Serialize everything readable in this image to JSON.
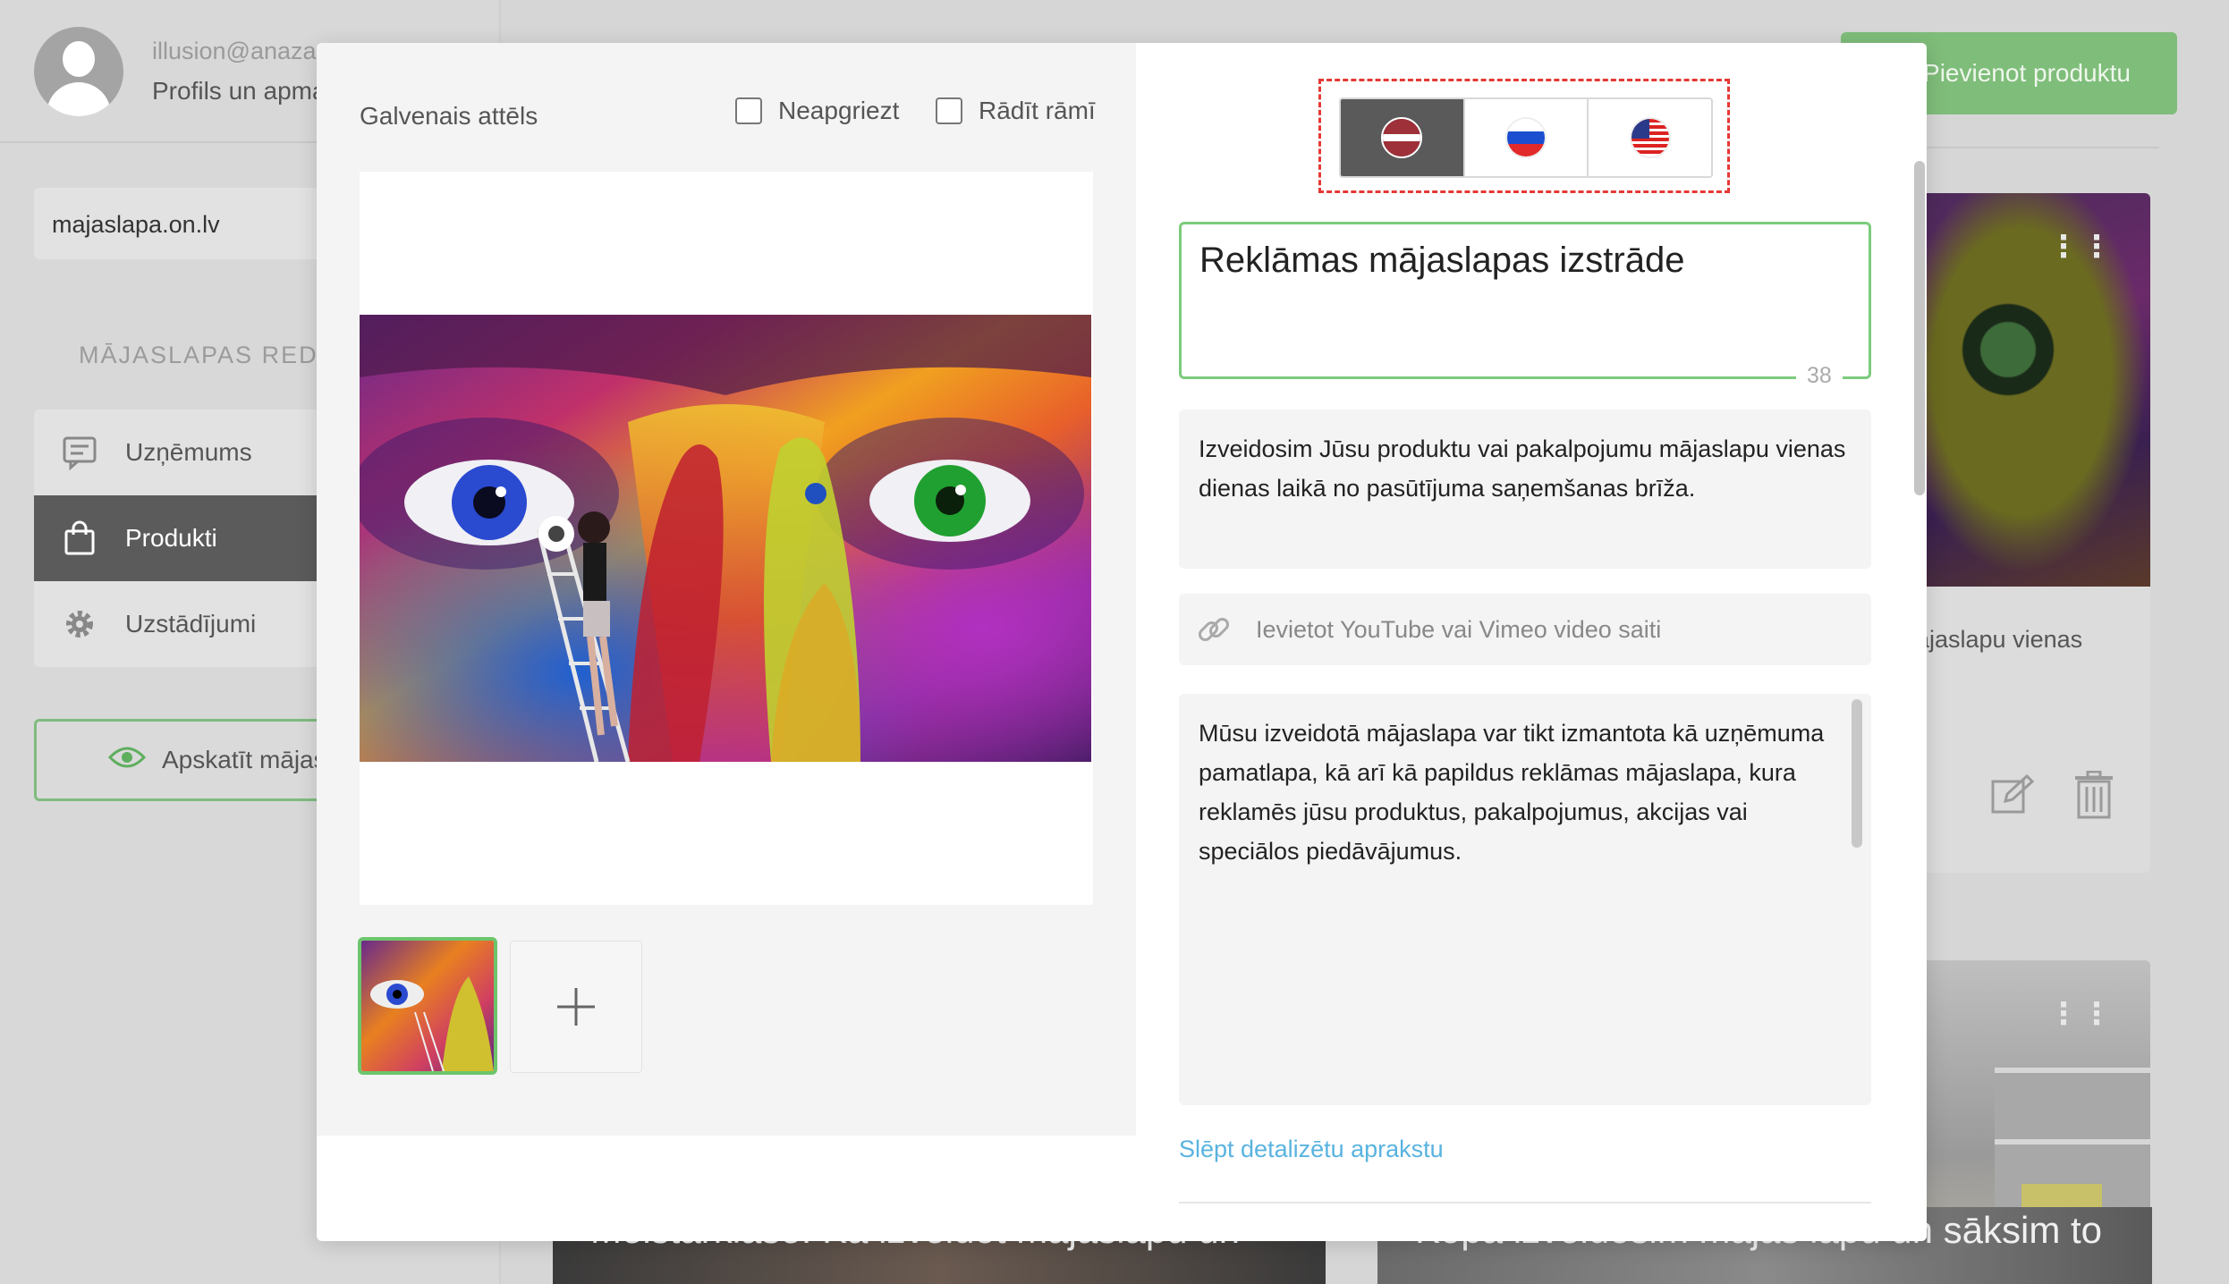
{
  "user": {
    "email": "illusion@anaza",
    "profile_link": "Profils un apma"
  },
  "sidebar": {
    "domain": "majaslapa.on.lv",
    "section_label": "MĀJASLAPAS REDI",
    "items": [
      {
        "label": "Uzņēmums",
        "icon": "chat-icon"
      },
      {
        "label": "Produkti",
        "icon": "shopping-bag-icon",
        "active": true
      },
      {
        "label": "Uzstādījumi",
        "icon": "gear-icon"
      }
    ],
    "view_site_label": "Apskatīt mājas"
  },
  "background": {
    "add_product_label": "Pievienot produktu",
    "card1_text": "ājaslapu vienas",
    "video1_title": "Meistarklase: Kā izveidot mājaslapu un",
    "video2_title": "Kopā izveidosim mājas lapu un sāksim to"
  },
  "modal": {
    "main_image_label": "Galvenais attēls",
    "uncropped_label": "Neapgriezt",
    "show_frame_label": "Rādīt rāmī",
    "languages": [
      {
        "code": "lv",
        "icon": "latvia-flag-icon",
        "active": true
      },
      {
        "code": "ru",
        "icon": "russia-flag-icon",
        "active": false
      },
      {
        "code": "en",
        "icon": "usa-flag-icon",
        "active": false
      }
    ],
    "title_value": "Reklāmas mājaslapas izstrāde",
    "title_char_count": "38",
    "short_description": "Izveidosim Jūsu produktu vai pakalpojumu mājaslapu vienas dienas laikā no pasūtījuma saņemšanas brīža.",
    "video_placeholder": "Ievietot YouTube vai Vimeo video saiti",
    "long_description": "Mūsu izveidotā mājaslapa var tikt izmantota kā uzņēmuma pamatlapa, kā arī kā papildus reklāmas mājaslapa, kura reklamēs jūsu produktus, pakalpojumus, akcijas vai speciālos piedāvājumus.",
    "hide_details_label": "Slēpt detalizētu aprakstu"
  },
  "colors": {
    "accent_green": "#7ccc7c",
    "link_blue": "#59b3e0",
    "language_highlight": "#e53935"
  }
}
